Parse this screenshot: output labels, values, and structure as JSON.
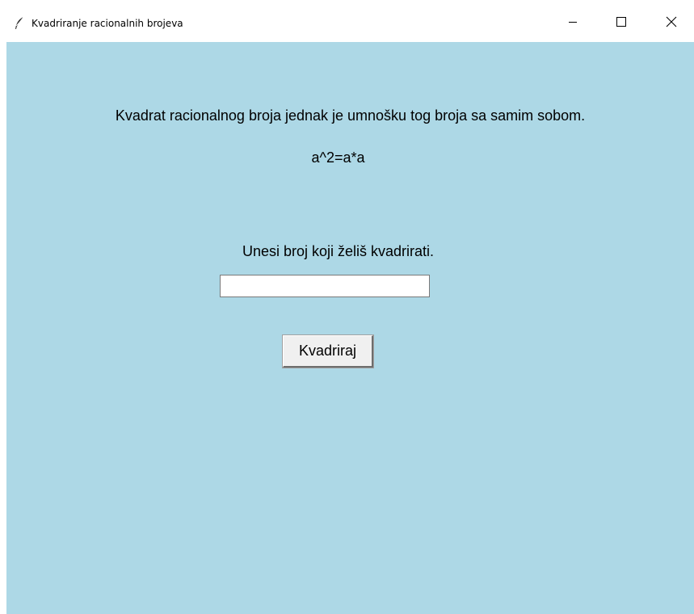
{
  "window": {
    "title": "Kvadriranje racionalnih brojeva",
    "controls": {
      "minimize": "minimize-icon",
      "maximize": "maximize-icon",
      "close": "close-icon"
    }
  },
  "content": {
    "description": "Kvadrat racionalnog broja jednak je umnošku tog broja sa samim sobom.",
    "formula": "a^2=a*a",
    "prompt": "Unesi broj koji želiš kvadrirati.",
    "input_value": "",
    "button_label": "Kvadriraj"
  },
  "colors": {
    "background": "#add8e6",
    "titlebar": "#ffffff",
    "button": "#f0f0f0"
  }
}
